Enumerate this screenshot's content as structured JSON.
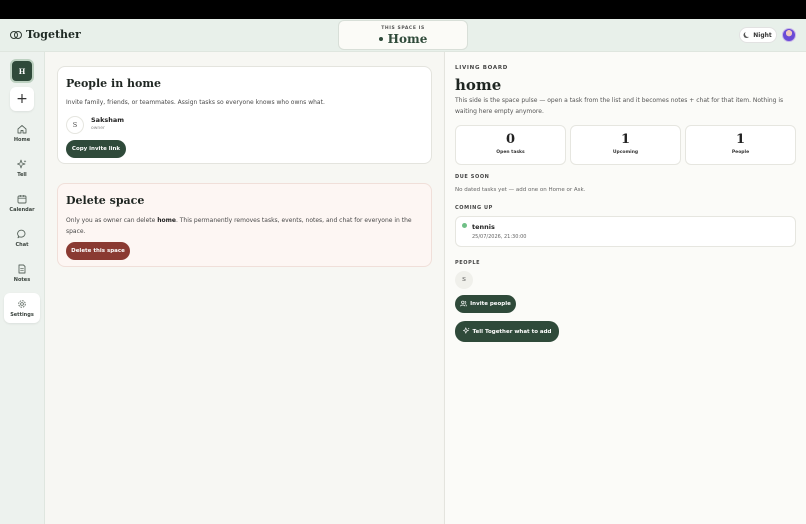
{
  "header": {
    "brand": "Together",
    "space_label": "THIS SPACE IS",
    "space_name": "Home",
    "night_label": "Night"
  },
  "sidebar": {
    "space_initial": "H",
    "add_label": "+",
    "items": [
      {
        "label": "Home",
        "icon": "home-icon"
      },
      {
        "label": "Tell",
        "icon": "sparkle-icon"
      },
      {
        "label": "Calendar",
        "icon": "calendar-icon"
      },
      {
        "label": "Chat",
        "icon": "chat-icon"
      },
      {
        "label": "Notes",
        "icon": "notes-icon"
      },
      {
        "label": "Settings",
        "icon": "gear-icon",
        "active": true
      }
    ]
  },
  "people_card": {
    "title": "People in home",
    "subtitle": "Invite family, friends, or teammates. Assign tasks so everyone knows who owns what.",
    "member": {
      "initial": "S",
      "name": "Saksham",
      "role": "owner"
    },
    "copy_button": "Copy invite link"
  },
  "delete_card": {
    "title": "Delete space",
    "desc_prefix": "Only you as owner can delete ",
    "desc_bold": "home",
    "desc_suffix": ". This permanently removes tasks, events, notes, and chat for everyone in the space.",
    "button": "Delete this space"
  },
  "board": {
    "kicker": "LIVING BOARD",
    "title": "home",
    "description": "This side is the space pulse — open a task from the list and it becomes notes + chat for that item. Nothing is waiting here empty anymore.",
    "stats": [
      {
        "value": "0",
        "label": "Open tasks"
      },
      {
        "value": "1",
        "label": "Upcoming"
      },
      {
        "value": "1",
        "label": "People"
      }
    ],
    "due_soon_label": "DUE SOON",
    "due_soon_empty": "No dated tasks yet — add one on Home or Ask.",
    "coming_up_label": "COMING UP",
    "event": {
      "title": "tennis",
      "date": "25/07/2026, 21:30:00"
    },
    "people_label": "PEOPLE",
    "people_initial": "S",
    "invite_button": "Invite people",
    "tell_button": "Tell Together what to add"
  },
  "colors": {
    "accent": "#2f4a3a",
    "danger": "#8a3a32",
    "event_dot": "#6fbf86"
  }
}
